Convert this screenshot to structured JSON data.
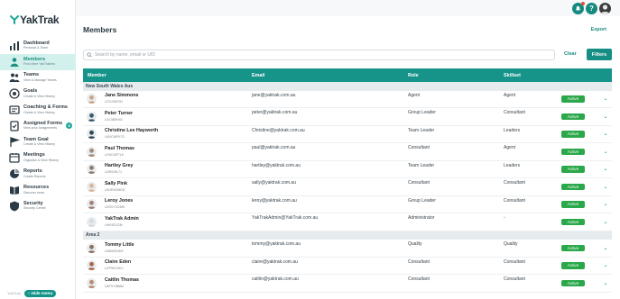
{
  "brand": {
    "name": "YakTrak",
    "accent": "#17948a",
    "active_green": "#2aa84a"
  },
  "sidebar": {
    "items": [
      {
        "title": "Dashboard",
        "sub": "Personal & Team",
        "icon": "dashboard-icon",
        "active": false
      },
      {
        "title": "Members",
        "sub": "Find other YakTrakers",
        "icon": "members-icon",
        "active": true
      },
      {
        "title": "Teams",
        "sub": "View & Manage Teams",
        "icon": "teams-icon",
        "active": false
      },
      {
        "title": "Goals",
        "sub": "Create & View History",
        "icon": "goals-icon",
        "active": false
      },
      {
        "title": "Coaching & Forms",
        "sub": "Create & View History",
        "icon": "coaching-icon",
        "active": false
      },
      {
        "title": "Assigned Forms",
        "sub": "View your Assignments",
        "icon": "forms-icon",
        "active": false,
        "badge": "4"
      },
      {
        "title": "Team Goal",
        "sub": "Create & View History",
        "icon": "team-goal-icon",
        "active": false
      },
      {
        "title": "Meetings",
        "sub": "Organise & View History",
        "icon": "meetings-icon",
        "active": false
      },
      {
        "title": "Reports",
        "sub": "Create Reports",
        "icon": "reports-icon",
        "active": false
      },
      {
        "title": "Resources",
        "sub": "Discover more",
        "icon": "resources-icon",
        "active": false
      },
      {
        "title": "Security",
        "sub": "Security Centre",
        "icon": "security-icon",
        "active": false
      }
    ],
    "footer_logo": "YakTrak",
    "hide_menu": "Hide menu"
  },
  "topbar": {
    "notifications_count": "",
    "help": "?"
  },
  "page": {
    "title": "Members",
    "export": "Export",
    "search_placeholder": "Search by name, email or UID",
    "clear": "Clear",
    "filters": "Filters"
  },
  "table": {
    "headers": {
      "member": "Member",
      "email": "Email",
      "role": "Role",
      "skillset": "Skillset"
    },
    "groups": [
      {
        "name": "New South Wales Aus",
        "rows": [
          {
            "name": "Jane Simmons",
            "uid": "U7ZJ2DF2D",
            "email": "jane@yaktrak.com.au",
            "role": "Agent",
            "skillset": "Agent",
            "status": "Active",
            "avatar": "#c9a58a"
          },
          {
            "name": "Peter Turner",
            "uid": "U2L3B0H40",
            "email": "peter@yaktrak.com.au",
            "role": "Group Leader",
            "skillset": "Consultant",
            "status": "Active",
            "avatar": "#3d5c6b"
          },
          {
            "name": "Christine Lee Hayworth",
            "uid": "U6VCMPX7O",
            "email": "Christine@yaktrak.com.au",
            "role": "Team Leader",
            "skillset": "Leaders",
            "status": "Active",
            "avatar": "#2f4a55"
          },
          {
            "name": "Paul Thomas",
            "uid": "UY6CMF7LK",
            "email": "paul@yaktrak.com.au",
            "role": "Consultant",
            "skillset": "Agent",
            "status": "Active",
            "avatar": "#a38a78"
          },
          {
            "name": "Hartley Grey",
            "uid": "U2R9J9L7J",
            "email": "hartley@yaktrak.com.au",
            "role": "Team Leader",
            "skillset": "Leaders",
            "status": "Active",
            "avatar": "#8c7a6e"
          },
          {
            "name": "Sally Pink",
            "uid": "UHJE9GMDD",
            "email": "sally@yaktrak.com.au",
            "role": "Consultant",
            "skillset": "Consultant",
            "status": "Active",
            "avatar": "#d9b59c"
          },
          {
            "name": "Leroy Jones",
            "uid": "U2SVY2G6RI",
            "email": "leroy@yaktrak.com.au",
            "role": "Group Leader",
            "skillset": "Consultant",
            "status": "Active",
            "avatar": "#9e8373"
          },
          {
            "name": "YakTrak Admin",
            "uid": "UHKEDZ2M",
            "email": "YakTrakAdmin@YakTrak.com.au",
            "role": "Administrator",
            "skillset": "-",
            "status": "Active",
            "avatar": "#d5dadd"
          }
        ]
      },
      {
        "name": "Area 2",
        "rows": [
          {
            "name": "Tommy Little",
            "uid": "UMM9SHMY",
            "email": "tommy@yaktrak.com.au",
            "role": "Quality",
            "skillset": "Quality",
            "status": "Active",
            "avatar": "#8a7062"
          },
          {
            "name": "Claire Eden",
            "uid": "U7P5KVSKJ",
            "email": "claire@yaktrak.com.au",
            "role": "Consultant",
            "skillset": "Consultant",
            "status": "Active",
            "avatar": "#a8654a"
          },
          {
            "name": "Caitlin Thomas",
            "uid": "U6TSY8B8M",
            "email": "caitlin@yaktrak.com.au",
            "role": "Consultant",
            "skillset": "Consultant",
            "status": "Active",
            "avatar": "#b48a72"
          }
        ]
      }
    ]
  }
}
